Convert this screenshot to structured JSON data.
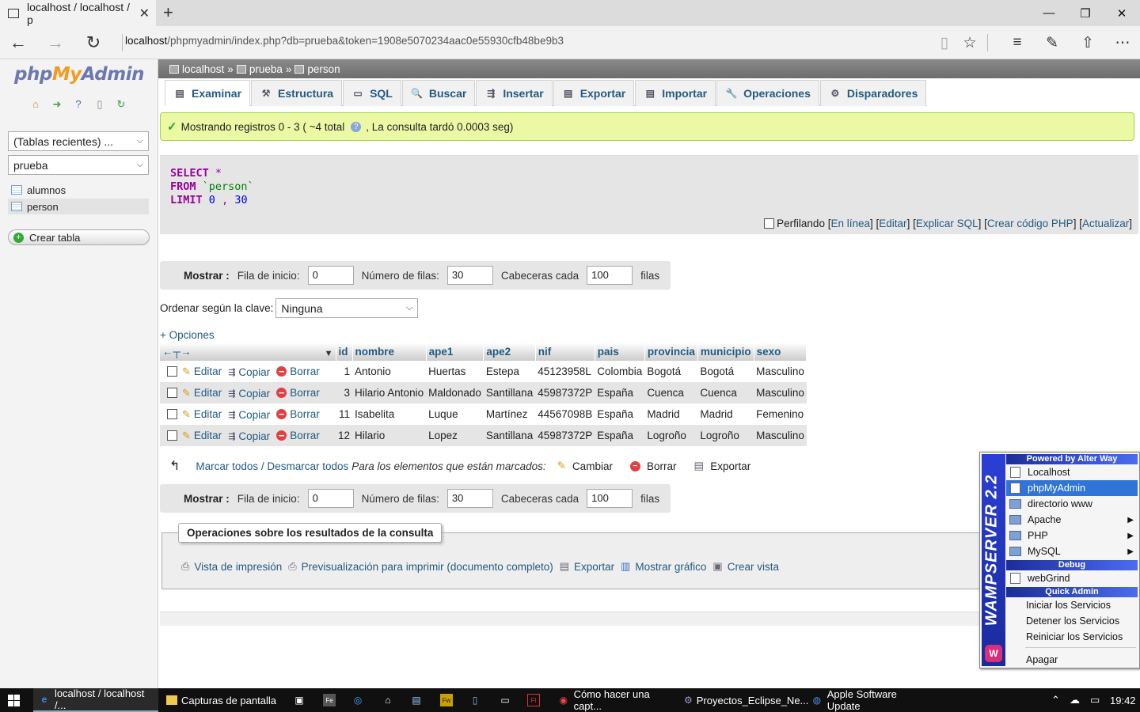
{
  "browser": {
    "tab_title": "localhost / localhost / p",
    "close": "✕",
    "new_tab": "+",
    "url_host": "localhost",
    "url_path": "/phpmyadmin/index.php?db=prueba&token=1908e5070234aac0e55930cfb48be9b3",
    "back": "←",
    "forward": "→",
    "refresh": "↻",
    "win_min": "—",
    "win_max": "❐",
    "win_close": "✕",
    "toolbar_icons": [
      "reading-view-icon",
      "favorite-star-icon",
      "hub-icon",
      "notes-icon",
      "share-icon",
      "more-icon"
    ]
  },
  "sidebar": {
    "logo_php": "php",
    "logo_my": "My",
    "logo_admin": "Admin",
    "recent_tables": "(Tablas recientes) ...",
    "db_select": "prueba",
    "tables": [
      "alumnos",
      "person"
    ],
    "create_table": "Crear tabla"
  },
  "breadcrumb": {
    "server": "localhost",
    "db": "prueba",
    "table": "person",
    "sep": "»"
  },
  "tabs": [
    {
      "label": "Examinar",
      "icon": "▤"
    },
    {
      "label": "Estructura",
      "icon": "⚒"
    },
    {
      "label": "SQL",
      "icon": "▭"
    },
    {
      "label": "Buscar",
      "icon": "🔍"
    },
    {
      "label": "Insertar",
      "icon": "⇶"
    },
    {
      "label": "Exportar",
      "icon": "▤"
    },
    {
      "label": "Importar",
      "icon": "▤"
    },
    {
      "label": "Operaciones",
      "icon": "🔧"
    },
    {
      "label": "Disparadores",
      "icon": "⚙"
    }
  ],
  "success": {
    "text_a": "Mostrando registros 0 - 3 ( ~4 total",
    "text_b": ", La consulta tardó 0.0003 seg)"
  },
  "sql": {
    "select": "SELECT",
    "star": "*",
    "from": "FROM",
    "table": "`person`",
    "limit": "LIMIT",
    "limit_a": "0",
    "limit_comma": ",",
    "limit_b": "30"
  },
  "sql_actions": {
    "profiling": "Perfilando",
    "inline": "En línea",
    "edit": "Editar",
    "explain": "Explicar SQL",
    "php": "Crear código PHP",
    "refresh": "Actualizar"
  },
  "nav": {
    "show": "Mostrar :",
    "start_label": "Fila de inicio:",
    "start_value": "0",
    "rows_label": "Número de filas:",
    "rows_value": "30",
    "headers_label": "Cabeceras cada",
    "headers_value": "100",
    "rows_suffix": "filas"
  },
  "sort": {
    "label": "Ordenar según la clave:",
    "value": "Ninguna"
  },
  "options_link": "+ Opciones",
  "table": {
    "columns": [
      "id",
      "nombre",
      "ape1",
      "ape2",
      "nif",
      "pais",
      "provincia",
      "municipio",
      "sexo"
    ],
    "action_labels": {
      "edit": "Editar",
      "copy": "Copiar",
      "delete": "Borrar"
    },
    "rows": [
      {
        "id": "1",
        "nombre": "Antonio",
        "ape1": "Huertas",
        "ape2": "Estepa",
        "nif": "45123958L",
        "pais": "Colombia",
        "provincia": "Bogotá",
        "municipio": "Bogotá",
        "sexo": "Masculino"
      },
      {
        "id": "3",
        "nombre": "Hilario Antonio",
        "ape1": "Maldonado",
        "ape2": "Santillana",
        "nif": "45987372P",
        "pais": "España",
        "provincia": "Cuenca",
        "municipio": "Cuenca",
        "sexo": "Masculino"
      },
      {
        "id": "11",
        "nombre": "Isabelita",
        "ape1": "Luque",
        "ape2": "Martínez",
        "nif": "44567098B",
        "pais": "España",
        "provincia": "Madrid",
        "municipio": "Madrid",
        "sexo": "Femenino"
      },
      {
        "id": "12",
        "nombre": "Hilario",
        "ape1": "Lopez",
        "ape2": "Santillana",
        "nif": "45987372P",
        "pais": "España",
        "provincia": "Logroño",
        "municipio": "Logroño",
        "sexo": "Masculino"
      }
    ]
  },
  "mark": {
    "check_all": "Marcar todos / Desmarcar todos",
    "with_selected": "Para los elementos que están marcados:",
    "change": "Cambiar",
    "delete": "Borrar",
    "export": "Exportar"
  },
  "ops": {
    "legend": "Operaciones sobre los resultados de la consulta",
    "print": "Vista de impresión",
    "print_full": "Previsualización para imprimir (documento completo)",
    "export": "Exportar",
    "chart": "Mostrar gráfico",
    "view": "Crear vista"
  },
  "wamp": {
    "brand": "WAMPSERVER 2.2",
    "powered": "Powered by Alter Way",
    "localhost": "Localhost",
    "phpmyadmin": "phpMyAdmin",
    "www": "directorio www",
    "apache": "Apache",
    "php": "PHP",
    "mysql": "MySQL",
    "debug": "Debug",
    "webgrind": "webGrind",
    "quick_admin": "Quick Admin",
    "start": "Iniciar los Servicios",
    "stop": "Detener los Servicios",
    "restart": "Reiniciar los Servicios",
    "shutdown": "Apagar"
  },
  "taskbar": {
    "edge": "localhost / localhost /...",
    "captures": "Capturas de pantalla",
    "chrome": "Cómo hacer una capt...",
    "eclipse": "Proyectos_Eclipse_Ne...",
    "apple": "Apple Software Update",
    "time": "19:42"
  },
  "colors": {
    "link": "#235a81",
    "success_bg": "#ebf8a4",
    "wamp_highlight": "#3074d8",
    "keyword": "#990099"
  }
}
